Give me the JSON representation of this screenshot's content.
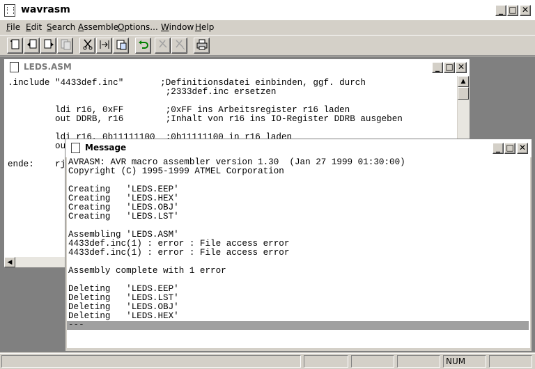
{
  "app": {
    "title": "wavrasm"
  },
  "menu": {
    "items": [
      {
        "label": "File",
        "underline": "F"
      },
      {
        "label": "Edit",
        "underline": "E"
      },
      {
        "label": "Search",
        "underline": "S"
      },
      {
        "label": "Assemble",
        "underline": "A"
      },
      {
        "label": "Options...",
        "underline": "O"
      },
      {
        "label": "Window",
        "underline": "W"
      },
      {
        "label": "Help",
        "underline": "H"
      }
    ]
  },
  "toolbar": {
    "buttons": [
      {
        "name": "new-file-icon",
        "enabled": true
      },
      {
        "name": "open-file-icon",
        "enabled": true
      },
      {
        "name": "save-file-icon",
        "enabled": true
      },
      {
        "name": "save-all-icon",
        "enabled": false
      },
      {
        "name": "cut-icon",
        "enabled": true
      },
      {
        "name": "copy-icon",
        "enabled": true
      },
      {
        "name": "paste-icon",
        "enabled": true
      },
      {
        "name": "undo-icon",
        "enabled": true
      },
      {
        "name": "find-icon",
        "enabled": false
      },
      {
        "name": "find-next-icon",
        "enabled": false
      },
      {
        "name": "print-icon",
        "enabled": true
      }
    ]
  },
  "editor": {
    "title": "LEDS.ASM",
    "lines": [
      ".include \"4433def.inc\"       ;Definitionsdatei einbinden, ggf. durch",
      "                              ;2333def.inc ersetzen",
      "",
      "         ldi r16, 0xFF        ;0xFF ins Arbeitsregister r16 laden",
      "         out DDRB, r16        ;Inhalt von r16 ins IO-Register DDRB ausgeben",
      "",
      "         ldi r16, 0b11111100  ;0b11111100 in r16 laden",
      "         out",
      "",
      "ende:    rj"
    ]
  },
  "message": {
    "title": "Message",
    "lines": [
      "AVRASM: AVR macro assembler version 1.30  (Jan 27 1999 01:30:00)",
      "Copyright (C) 1995-1999 ATMEL Corporation",
      "",
      "Creating   'LEDS.EEP'",
      "Creating   'LEDS.HEX'",
      "Creating   'LEDS.OBJ'",
      "Creating   'LEDS.LST'",
      "",
      "Assembling 'LEDS.ASM'",
      "4433def.inc(1) : error : File access error",
      "4433def.inc(1) : error : File access error",
      "",
      "Assembly complete with 1 error",
      "",
      "Deleting   'LEDS.EEP'",
      "Deleting   'LEDS.LST'",
      "Deleting   'LEDS.OBJ'",
      "Deleting   'LEDS.HEX'",
      "---"
    ]
  },
  "status": {
    "num": "NUM"
  }
}
